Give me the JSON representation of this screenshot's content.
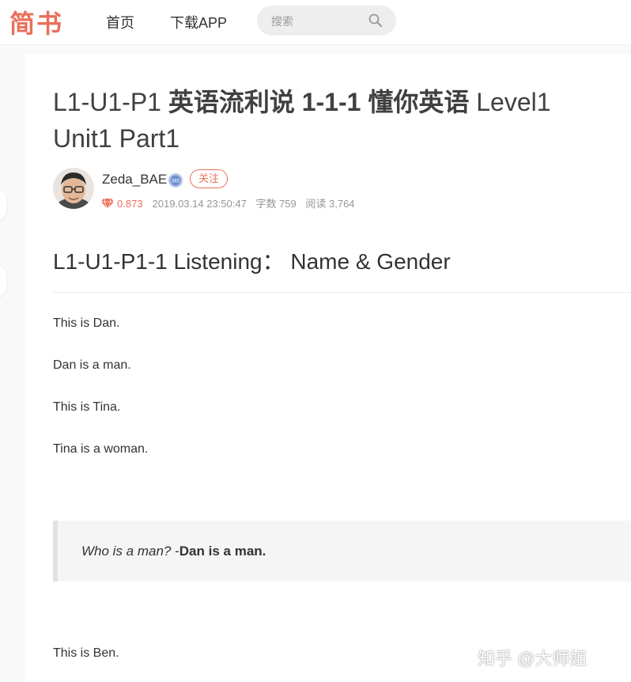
{
  "header": {
    "logo": "简书",
    "nav": {
      "home": "首页",
      "download": "下载APP"
    },
    "search": {
      "placeholder": "搜索",
      "value": ""
    }
  },
  "article": {
    "title_prefix": "L1-U1-P1",
    "title_cn": "英语流利说 1-1-1 懂你英语",
    "title_suffix": "Level1 Unit1 Part1",
    "author": {
      "name": "Zeda_BAE",
      "follow_label": "关注",
      "score": "0.873",
      "date": "2019.03.14 23:50:47",
      "word_count": "字数 759",
      "reads": "阅读 3,764"
    },
    "section_heading": "L1-U1-P1-1 Listening： Name & Gender",
    "paragraphs": [
      "This is Dan.",
      "Dan is a man.",
      "This is Tina.",
      "Tina is a woman.",
      "This is Ben."
    ],
    "quote": {
      "question": "Who is a man?",
      "separator": " -",
      "answer": "Dan is a man."
    }
  },
  "watermark": "知乎 @大师姐",
  "colors": {
    "brand": "#ea6f5a",
    "text": "#404040",
    "meta": "#969696",
    "quote_bg": "#f5f5f5",
    "quote_border": "#e2e2e2"
  }
}
